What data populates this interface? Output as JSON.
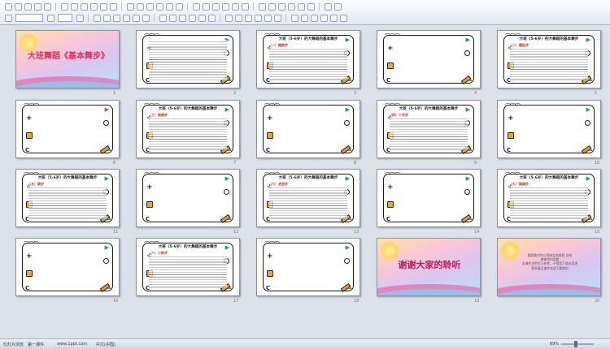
{
  "toolbar": {
    "row1_buttons": 31,
    "row2_buttons": 29
  },
  "deck": {
    "main_title": "大班舞蹈《基本舞步》",
    "heading": "大班（5-6岁）的大舞蹈的基本舞步",
    "thanks": "谢谢大家的聆听",
    "closing_lines": "舞蹈教学的心得体会和收获 总结\n感谢您的观看\n本课件仅供学习参考，不得用于商业用途\n更多精品课件欢迎下载使用"
  },
  "slides": [
    {
      "num": "1",
      "layout": "title"
    },
    {
      "num": "2",
      "layout": "text"
    },
    {
      "num": "3",
      "layout": "text",
      "sub": "（一）踏跳步"
    },
    {
      "num": "4",
      "layout": "blank"
    },
    {
      "num": "5",
      "layout": "text",
      "sub": "（二）踵趾步"
    },
    {
      "num": "6",
      "layout": "blank"
    },
    {
      "num": "7",
      "layout": "text",
      "sub": "（三）跑跳步"
    },
    {
      "num": "8",
      "layout": "blank"
    },
    {
      "num": "9",
      "layout": "text",
      "sub": "（四）十字步"
    },
    {
      "num": "10",
      "layout": "blank"
    },
    {
      "num": "11",
      "layout": "text",
      "sub": "（五）跳步"
    },
    {
      "num": "12",
      "layout": "blank"
    },
    {
      "num": "13",
      "layout": "text",
      "sub": "（六）进退步"
    },
    {
      "num": "14",
      "layout": "blank"
    },
    {
      "num": "15",
      "layout": "text",
      "sub": "（七）跳踢步"
    },
    {
      "num": "16",
      "layout": "blank"
    },
    {
      "num": "17",
      "layout": "text",
      "sub": "（八）小碎步"
    },
    {
      "num": "18",
      "layout": "blank"
    },
    {
      "num": "19",
      "layout": "thanks"
    },
    {
      "num": "20",
      "layout": "closing"
    }
  ],
  "status": {
    "slide_sorter": "幻灯片浏览",
    "design": "第一课件",
    "watermark": "www.1ppt.com",
    "lang": "中文(中国)",
    "zoom": "69%"
  }
}
